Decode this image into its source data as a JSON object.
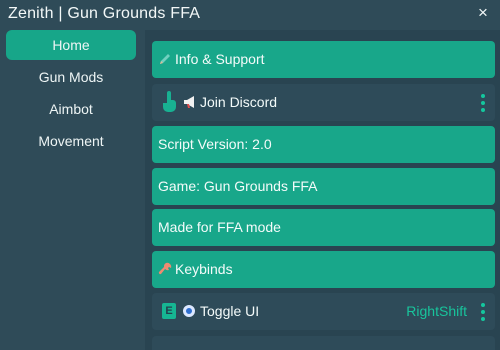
{
  "window": {
    "title": "Zenith | Gun Grounds FFA",
    "close_glyph": "×"
  },
  "sidebar": {
    "items": [
      {
        "label": "Home",
        "active": true
      },
      {
        "label": "Gun Mods",
        "active": false
      },
      {
        "label": "Aimbot",
        "active": false
      },
      {
        "label": "Movement",
        "active": false
      }
    ]
  },
  "main": {
    "info_support": "Info & Support",
    "join_discord": "Join Discord",
    "script_version": "Script Version: 2.0",
    "game": "Game: Gun Grounds FFA",
    "made_for": "Made for FFA mode",
    "keybinds": "Keybinds",
    "toggle_ui": {
      "key_badge": "E",
      "label": "Toggle UI",
      "value": "RightShift"
    }
  },
  "colors": {
    "accent": "#18a78a",
    "background": "#2f4b58",
    "panel": "#294451",
    "text": "#f2f7f7",
    "value_text": "#18c49c",
    "toggle_dot": "#2f6fd0"
  },
  "icons": {
    "info_support": "pencil-icon",
    "join_discord": "megaphone-icon",
    "keybinds": "wrench-icon",
    "discord_left": "hand-pointer-icon",
    "toggle_ui_left": "e-key-icon",
    "toggle_ui_dot": "toggle-dot-icon",
    "menu": "kebab-menu-icon"
  }
}
